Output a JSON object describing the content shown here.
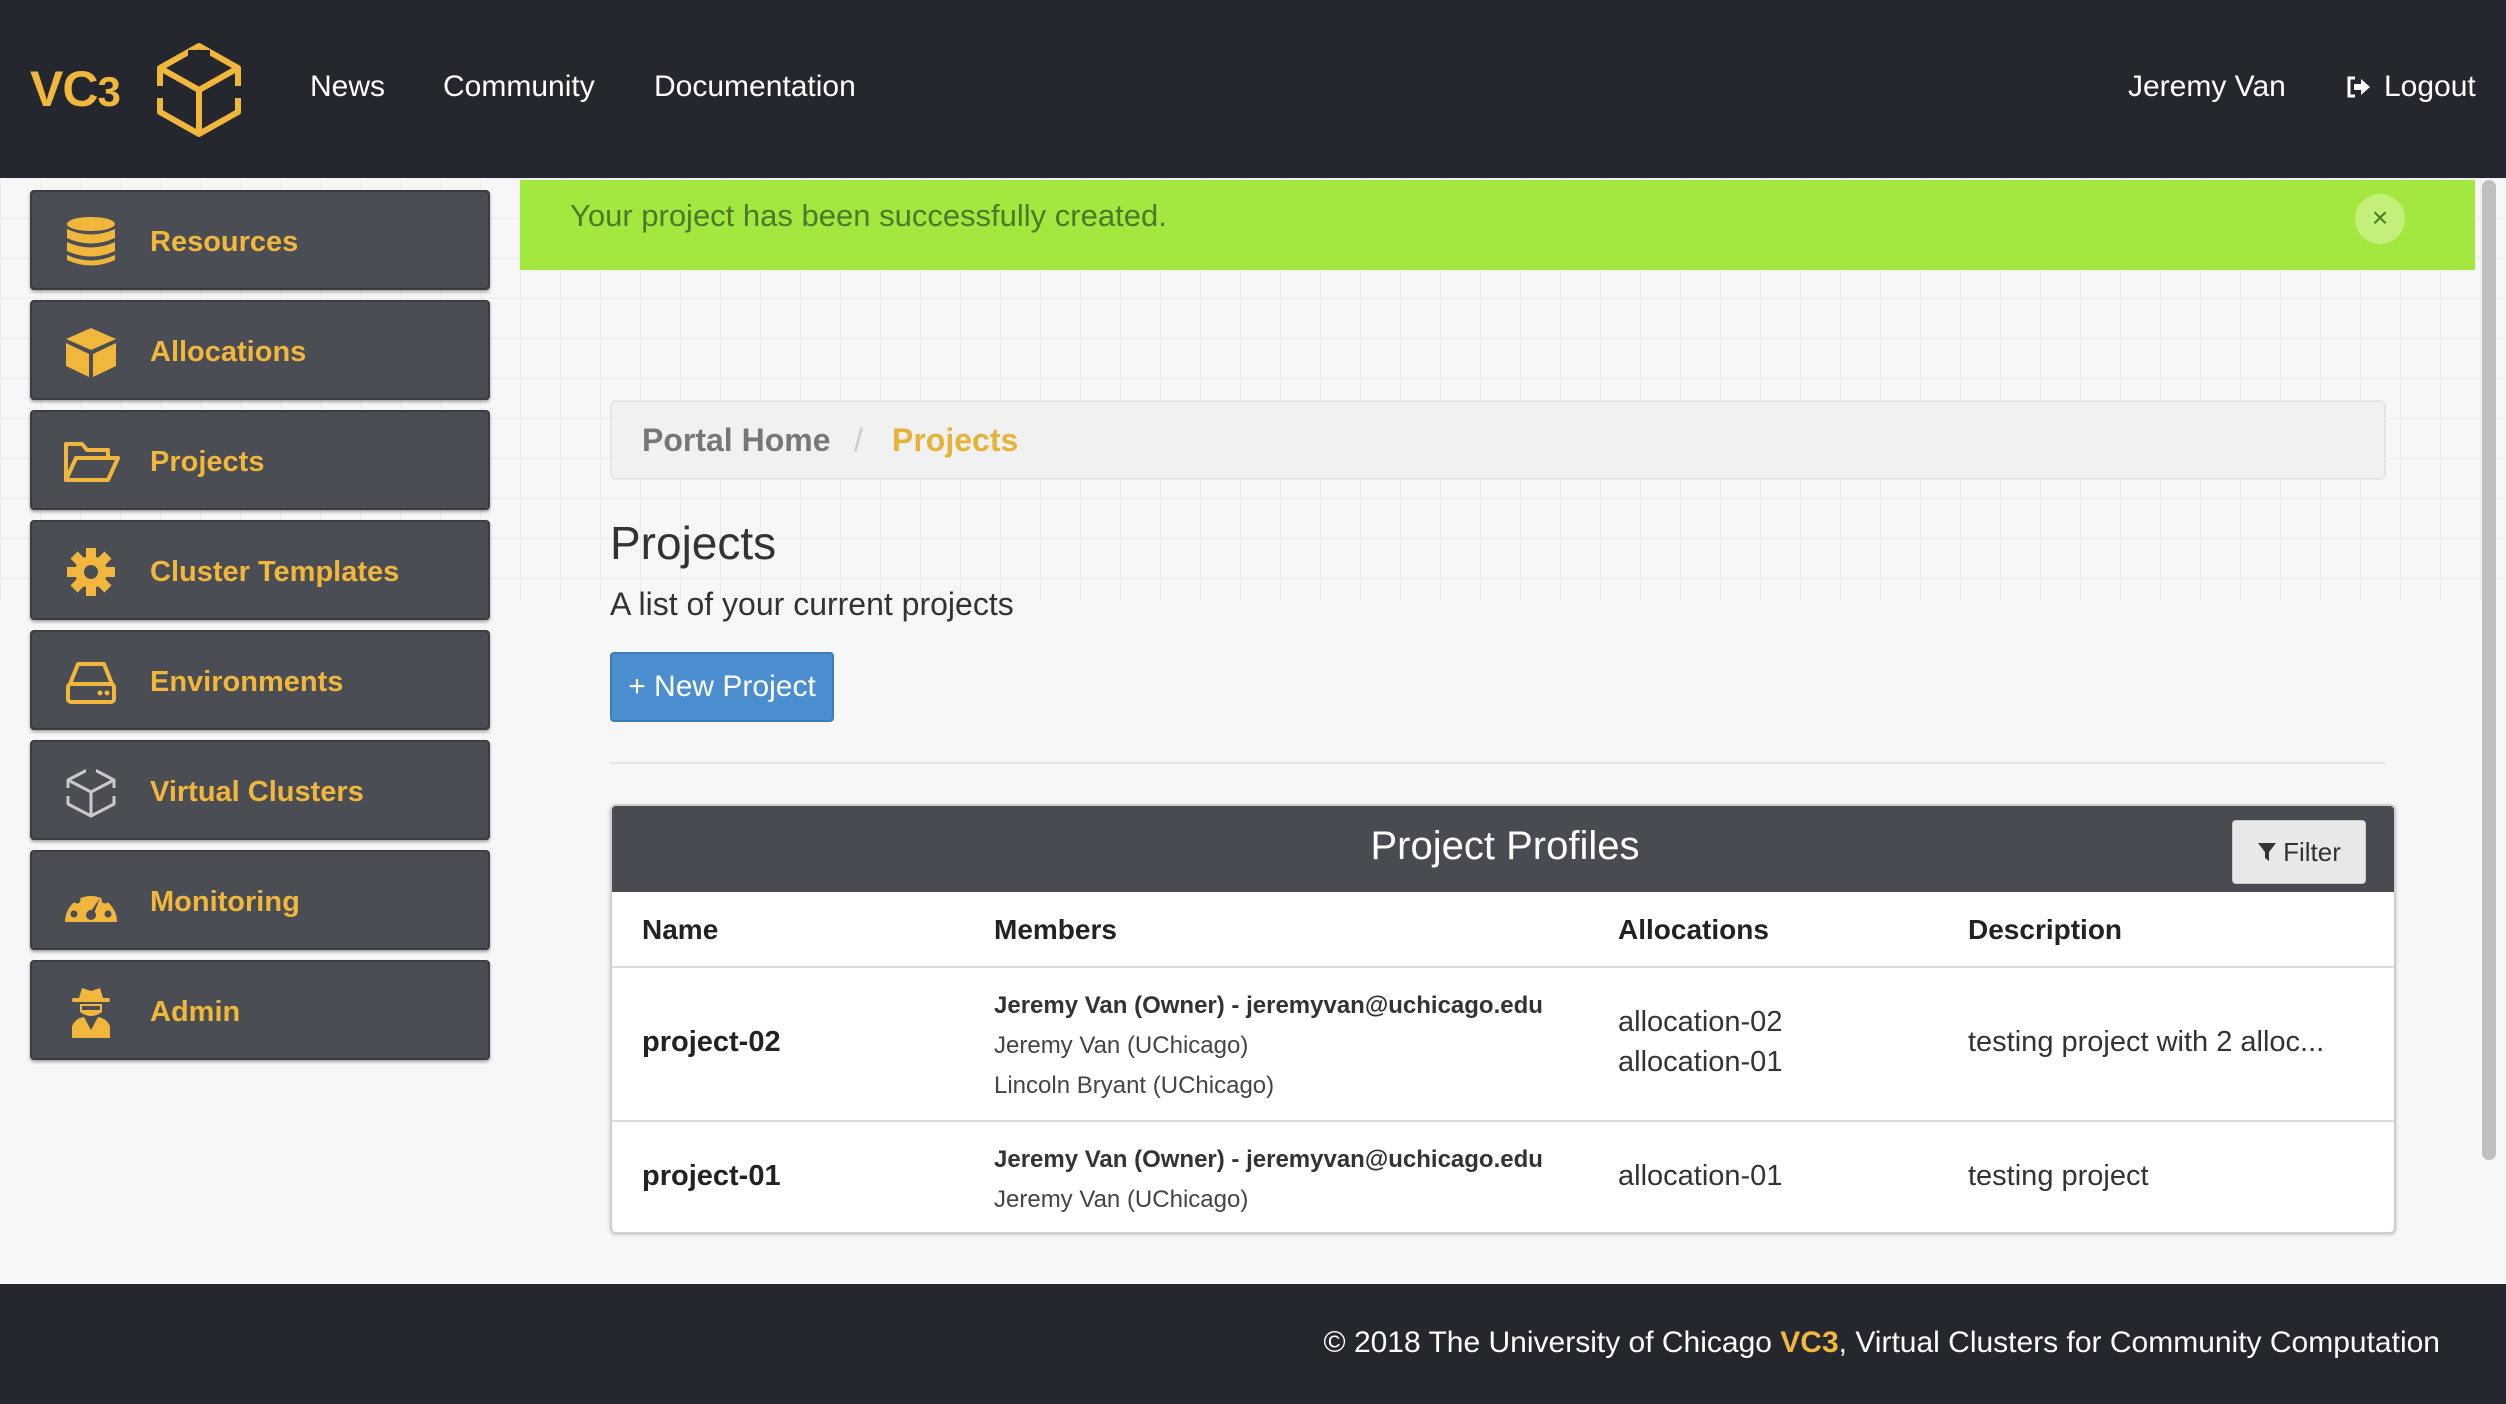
{
  "navbar": {
    "brand": "VC",
    "brand_sub": "3",
    "links": [
      "News",
      "Community",
      "Documentation"
    ],
    "user": "Jeremy Van",
    "logout": "Logout"
  },
  "sidebar": {
    "items": [
      {
        "label": "Resources",
        "icon": "database-icon"
      },
      {
        "label": "Allocations",
        "icon": "cube-icon"
      },
      {
        "label": "Projects",
        "icon": "folder-open-icon"
      },
      {
        "label": "Cluster Templates",
        "icon": "gear-icon"
      },
      {
        "label": "Environments",
        "icon": "hard-drive-icon"
      },
      {
        "label": "Virtual Clusters",
        "icon": "vc3-logo-icon"
      },
      {
        "label": "Monitoring",
        "icon": "dashboard-icon"
      },
      {
        "label": "Admin",
        "icon": "user-secret-icon"
      }
    ]
  },
  "alert": {
    "message": "Your project has been successfully created.",
    "close": "×",
    "color": "#a3e83f"
  },
  "breadcrumb": {
    "home": "Portal Home",
    "separator": "/",
    "current": "Projects"
  },
  "page": {
    "title": "Projects",
    "subtitle": "A list of your current projects",
    "new_button": "+ New Project"
  },
  "table": {
    "title": "Project Profiles",
    "filter": "Filter",
    "columns": [
      "Name",
      "Members",
      "Allocations",
      "Description"
    ],
    "rows": [
      {
        "name": "project-02",
        "members": [
          "Jeremy Van (Owner) - jeremyvan@uchicago.edu",
          "Jeremy Van (UChicago)",
          "Lincoln Bryant (UChicago)"
        ],
        "allocations": [
          "allocation-02",
          "allocation-01"
        ],
        "description": "testing project with 2 alloc..."
      },
      {
        "name": "project-01",
        "members": [
          "Jeremy Van (Owner) - jeremyvan@uchicago.edu",
          "Jeremy Van (UChicago)"
        ],
        "allocations": [
          "allocation-01"
        ],
        "description": "testing project"
      }
    ]
  },
  "footer": {
    "prefix": "© 2018 The University of Chicago ",
    "brand": "VC3",
    "suffix": ", Virtual Clusters for Community Computation"
  },
  "colors": {
    "accent": "#f0b73c",
    "navbar": "#24272d",
    "sidebar_item": "#4b4d55",
    "primary_button": "#4a8ed0"
  }
}
